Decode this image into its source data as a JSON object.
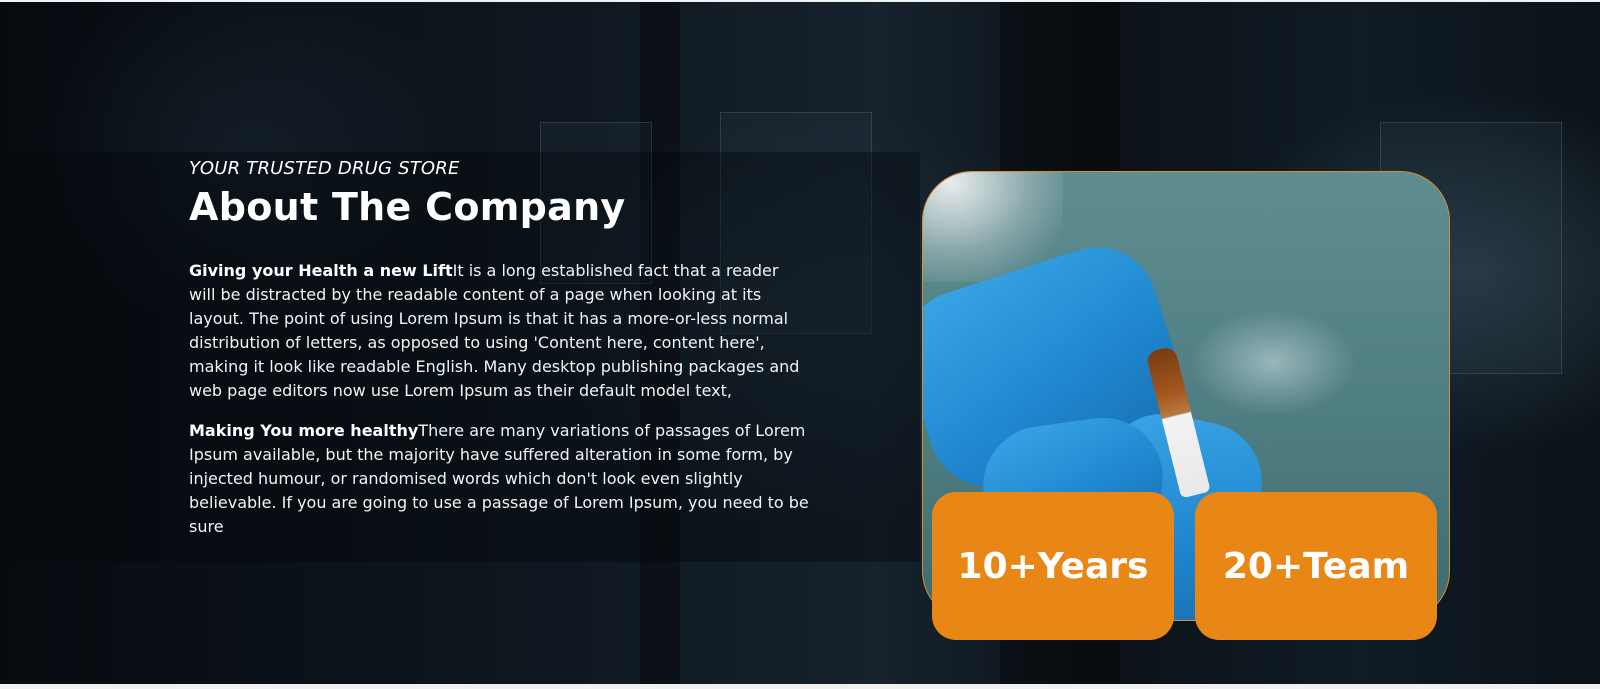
{
  "about": {
    "tagline": "YOUR TRUSTED DRUG STORE",
    "title": "About The Company",
    "paragraphs": [
      {
        "lead": "Giving your Health a new Lift",
        "text": "It is a long established fact that a reader will be distracted by the readable content of a page when looking at its layout. The point of using Lorem Ipsum is that it has a more-or-less normal distribution of letters, as opposed to using 'Content here, content here', making it look like readable English. Many desktop publishing packages and web page editors now use Lorem Ipsum as their default model text,"
      },
      {
        "lead": "Making You more healthy",
        "text": "There are many variations of passages of Lorem Ipsum available, but the majority have suffered alteration in some form, by injected humour, or randomised words which don't look even slightly believable. If you are going to use a passage of Lorem Ipsum, you need to be sure"
      }
    ]
  },
  "stats": [
    {
      "label": "10+Years"
    },
    {
      "label": "20+Team"
    }
  ],
  "colors": {
    "accent": "#e88616",
    "hero_bg": "#0d151d",
    "text": "#ffffff"
  }
}
